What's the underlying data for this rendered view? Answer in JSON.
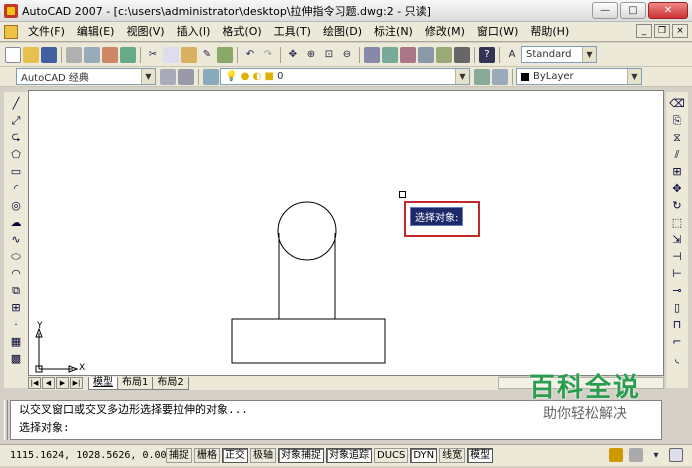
{
  "window": {
    "title": "AutoCAD 2007 - [c:\\users\\administrator\\desktop\\拉伸指令习题.dwg:2 - 只读]",
    "minimize": "—",
    "maximize": "□",
    "close": "✕"
  },
  "menubar": {
    "items": [
      "文件(F)",
      "编辑(E)",
      "视图(V)",
      "插入(I)",
      "格式(O)",
      "工具(T)",
      "绘图(D)",
      "标注(N)",
      "修改(M)",
      "窗口(W)",
      "帮助(H)"
    ],
    "mdi_min": "_",
    "mdi_max": "❐",
    "mdi_close": "×"
  },
  "toolbar": {
    "text_style": "Standard"
  },
  "toolbar2": {
    "workspace": "AutoCAD 经典",
    "layer": "0",
    "color": "ByLayer",
    "color_swatch": "#000000"
  },
  "layout_tabs": [
    "模型",
    "布局1",
    "布局2"
  ],
  "active_tab": "模型",
  "canvas": {
    "axis_x": "X",
    "axis_y": "Y",
    "tooltip": "选择对象:"
  },
  "command": {
    "history": "以交叉窗口或交叉多边形选择要拉伸的对象...",
    "prompt": "选择对象:"
  },
  "status": {
    "coords": "1115.1624, 1028.5626, 0.0000",
    "buttons": [
      {
        "label": "捕捉",
        "on": false
      },
      {
        "label": "栅格",
        "on": false
      },
      {
        "label": "正交",
        "on": true
      },
      {
        "label": "极轴",
        "on": false
      },
      {
        "label": "对象捕捉",
        "on": true
      },
      {
        "label": "对象追踪",
        "on": true
      },
      {
        "label": "DUCS",
        "on": false
      },
      {
        "label": "DYN",
        "on": true
      },
      {
        "label": "线宽",
        "on": false
      },
      {
        "label": "模型",
        "on": true
      }
    ]
  },
  "watermark": {
    "line1": "百科全说",
    "line2": "助你轻松解决"
  }
}
